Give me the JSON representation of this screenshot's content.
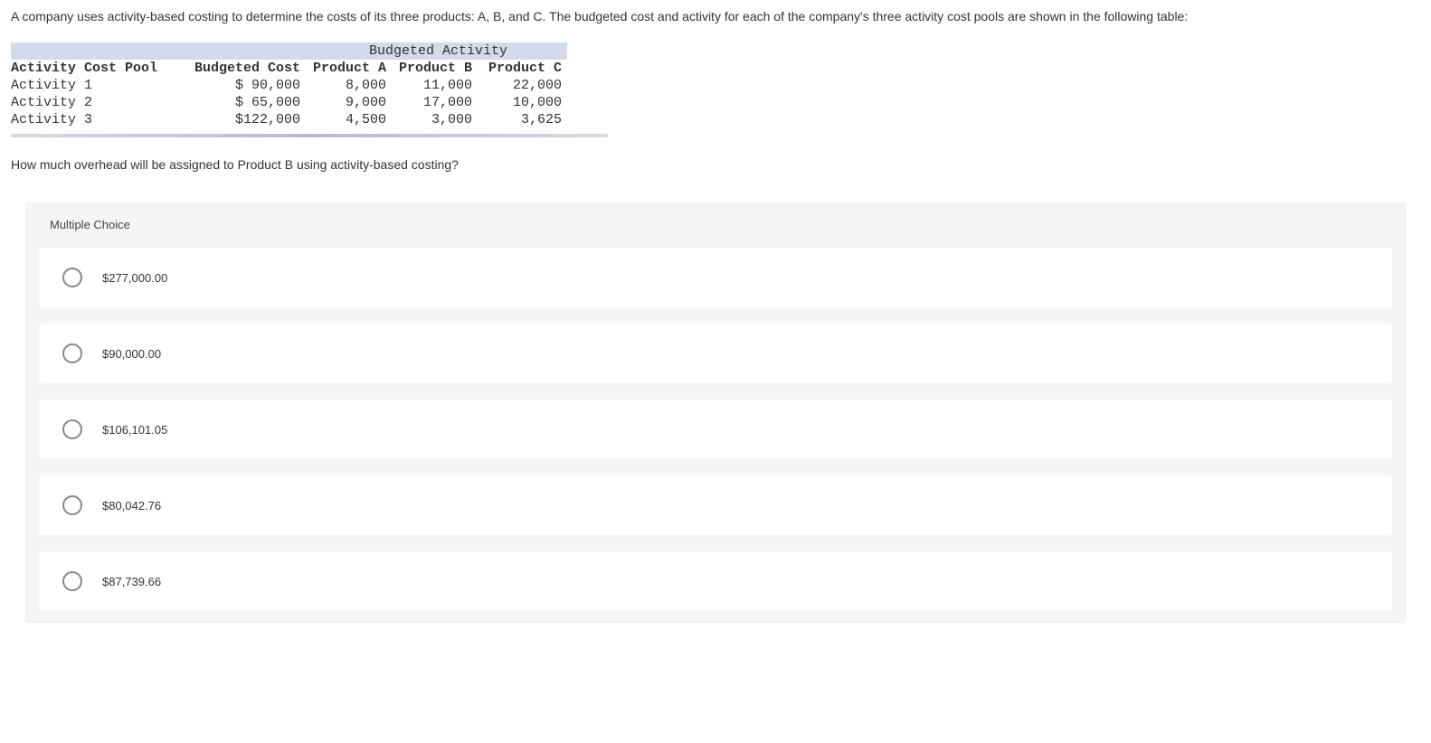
{
  "question": {
    "intro": "A company uses activity-based costing to determine the costs of its three products: A, B, and C. The budgeted cost and activity for each of the company's three activity cost pools are shown in the following table:",
    "followup": "How much overhead will be assigned to Product B using activity-based costing?"
  },
  "table": {
    "super_header": "Budgeted Activity",
    "headers": {
      "pool": "Activity Cost Pool",
      "cost": "Budgeted Cost",
      "a": "Product A",
      "b": "Product B",
      "c": "Product C"
    },
    "rows": [
      {
        "pool": "Activity 1",
        "cost": "$ 90,000",
        "a": "8,000",
        "b": "11,000",
        "c": "22,000"
      },
      {
        "pool": "Activity 2",
        "cost": "$ 65,000",
        "a": "9,000",
        "b": "17,000",
        "c": "10,000"
      },
      {
        "pool": "Activity 3",
        "cost": "$122,000",
        "a": "4,500",
        "b": "3,000",
        "c": "3,625"
      }
    ]
  },
  "mc": {
    "heading": "Multiple Choice",
    "options": [
      "$277,000.00",
      "$90,000.00",
      "$106,101.05",
      "$80,042.76",
      "$87,739.66"
    ]
  }
}
